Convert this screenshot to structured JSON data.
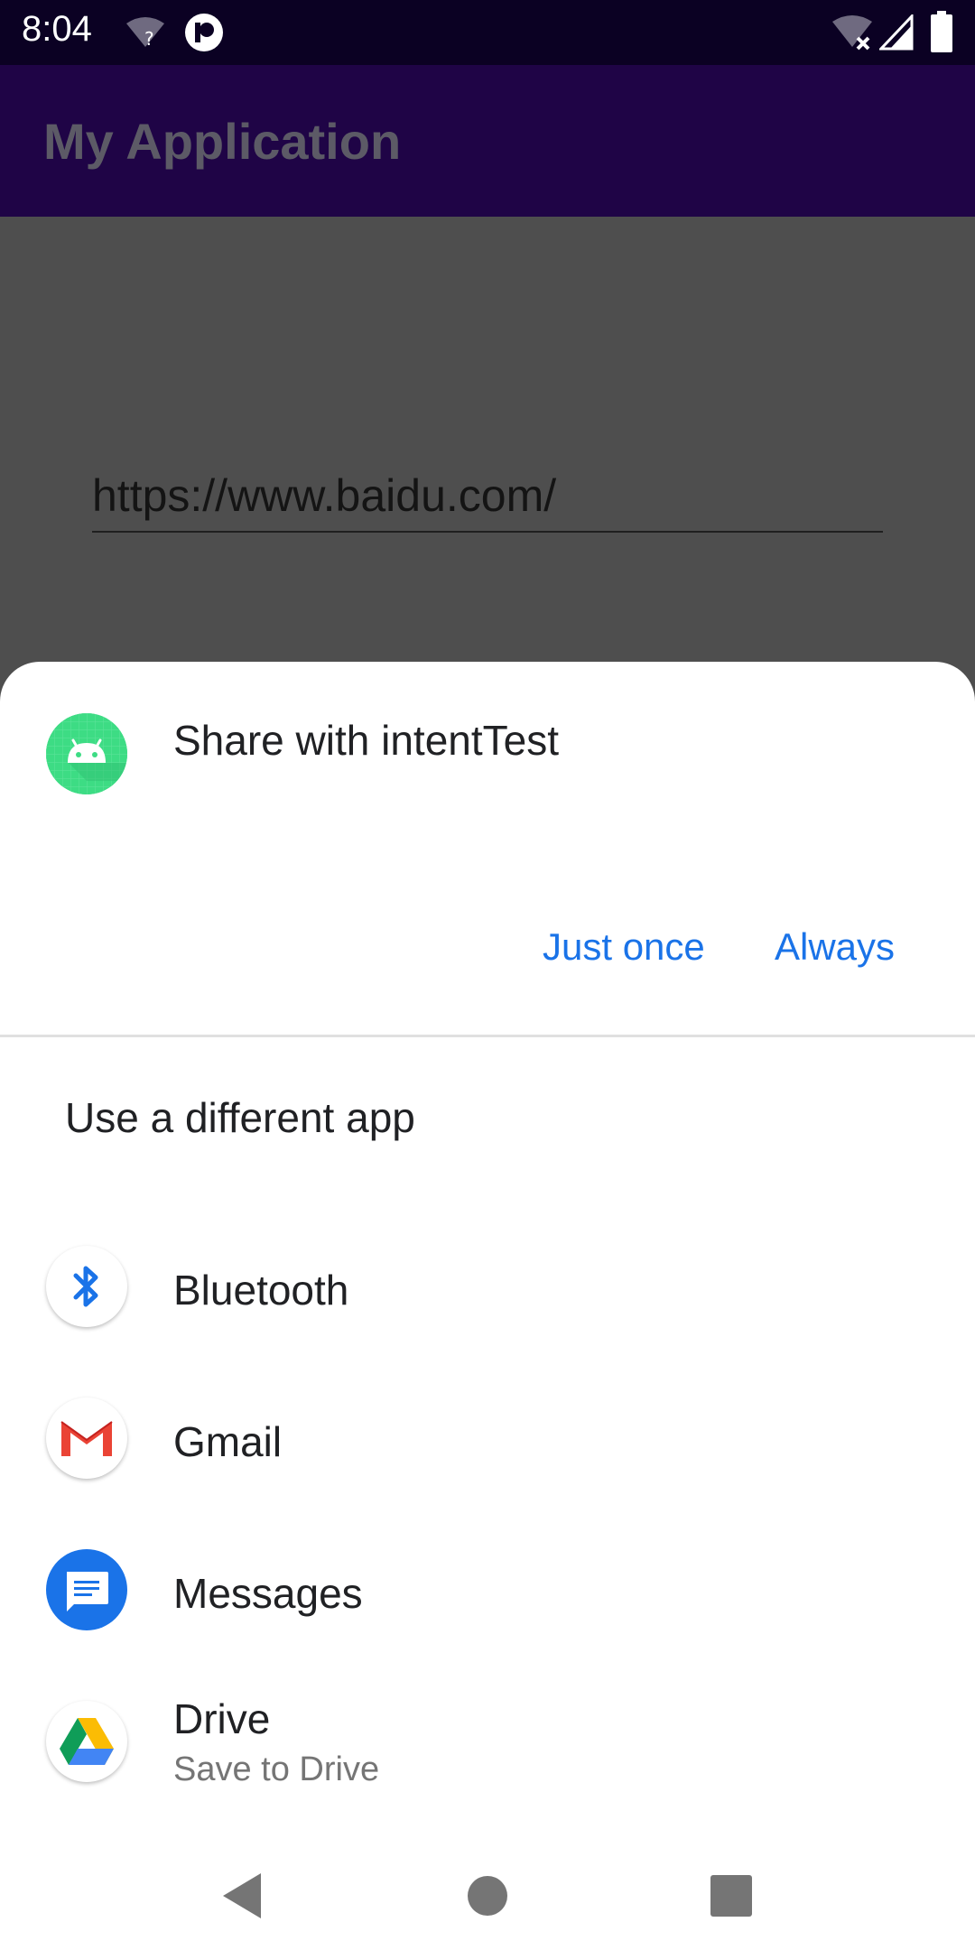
{
  "status_bar": {
    "time": "8:04",
    "icons": [
      "wifi-unknown-icon",
      "app-notification-icon",
      "wifi-off-icon",
      "cell-signal-icon",
      "battery-icon"
    ]
  },
  "app_bar": {
    "title": "My Application"
  },
  "main": {
    "url_value": "https://www.baidu.com/"
  },
  "sheet": {
    "title": "Share with intentTest",
    "just_once_label": "Just once",
    "always_label": "Always",
    "different_app_label": "Use a different app",
    "apps": [
      {
        "name": "Bluetooth",
        "icon": "bluetooth-icon"
      },
      {
        "name": "Gmail",
        "icon": "gmail-icon"
      },
      {
        "name": "Messages",
        "icon": "messages-icon"
      },
      {
        "name": "Drive",
        "subtitle": "Save to Drive",
        "icon": "drive-icon"
      }
    ]
  },
  "nav_bar": {
    "icons": [
      "back-icon",
      "home-icon",
      "recents-icon"
    ]
  },
  "colors": {
    "accent": "#1a73e8",
    "app_bar": "#1f0446",
    "status_bar": "#0b0123",
    "scrim": "#4e4e4e"
  }
}
